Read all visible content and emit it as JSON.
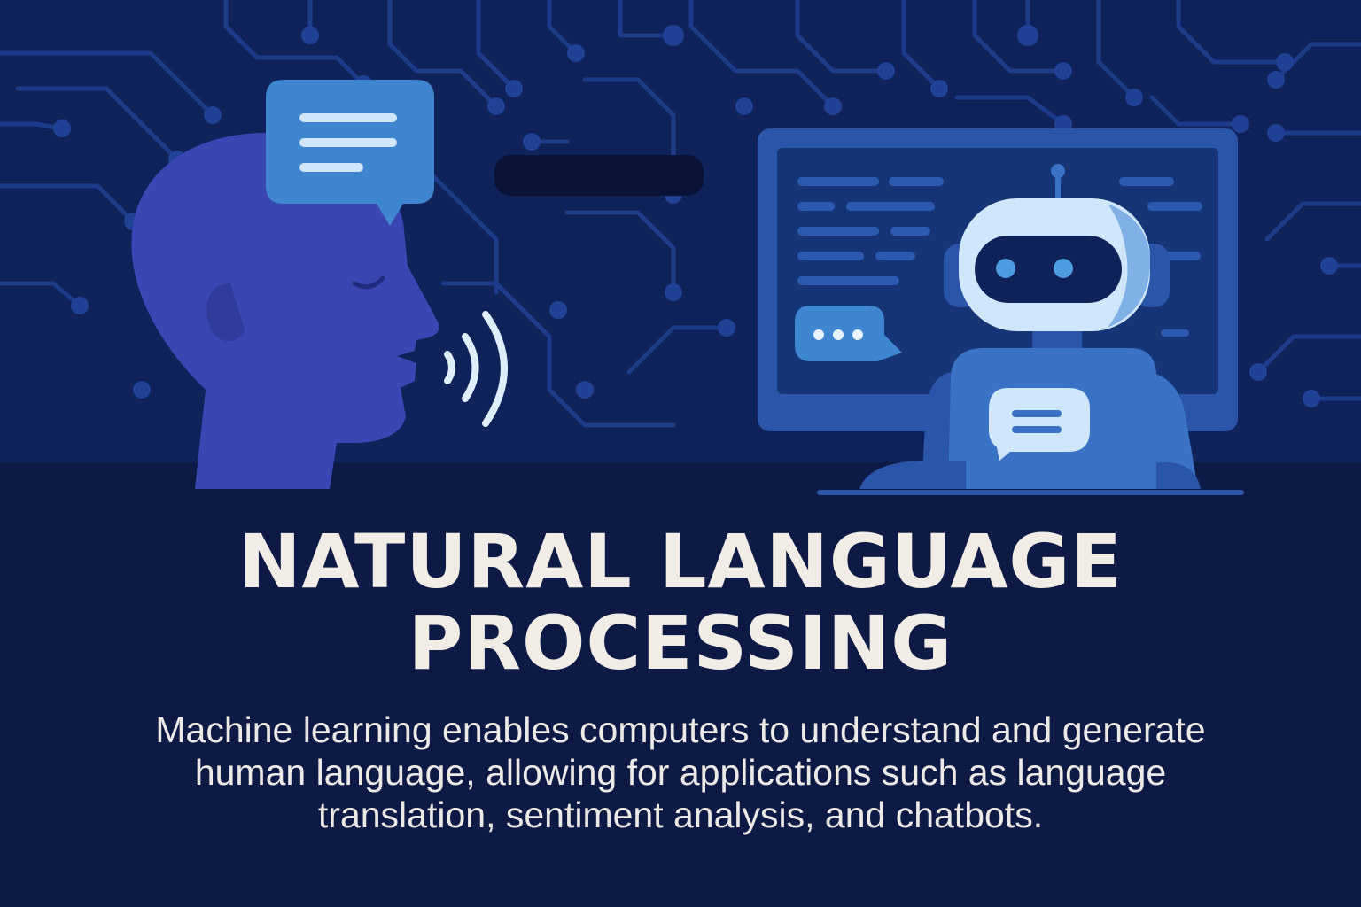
{
  "title": {
    "line1": "NATURAL LANGUAGE",
    "line2": "PROCESSING"
  },
  "description": {
    "line1": "Machine learning enables computers to understand and generate",
    "line2": "human language, allowing for applications such as language",
    "line3": "translation, sentiment analysis, and chatbots."
  },
  "icons": [
    "human-head-icon",
    "speech-bubble-icon",
    "sound-waves-icon",
    "monitor-icon",
    "robot-icon",
    "typing-bubble-icon",
    "circuit-pattern"
  ],
  "colors": {
    "background_top": "#0f2259",
    "background_bottom": "#0d1a45",
    "circuit": "#1b3a86",
    "head": "#3a46b4",
    "bubble": "#3e86d0",
    "robot_face": "#cfe6fb",
    "robot_body": "#3a73c6",
    "text": "#f1ede6"
  }
}
